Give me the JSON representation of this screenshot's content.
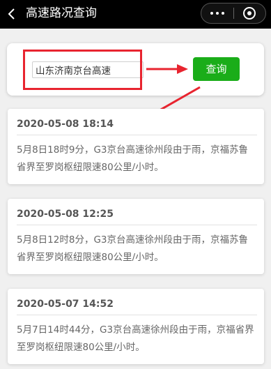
{
  "nav": {
    "title": "高速路况查询"
  },
  "search": {
    "value": "山东济南京台高速",
    "button_label": "查询"
  },
  "results": [
    {
      "time": "2020-05-08 18:14",
      "text": "5月8日18时9分，G3京台高速徐州段由于雨，京福苏鲁省界至罗岗枢纽限速80公里/小时。"
    },
    {
      "time": "2020-05-08 12:25",
      "text": "5月8日12时8分，G3京台高速徐州段由于雨，京福苏鲁省界至罗岗枢纽限速80公里/小时。"
    },
    {
      "time": "2020-05-07 14:52",
      "text": "5月7日14时44分，G3京台高速徐州段由于雨，京福省界至罗岗枢纽限速80公里/小时。"
    }
  ],
  "colors": {
    "nav_bg": "#000000",
    "accent_button": "#1aad19",
    "annotation_red": "#e8242f"
  },
  "icons": {
    "back": "chevron-left-icon",
    "more": "more-dots-icon",
    "close": "target-circle-icon"
  }
}
